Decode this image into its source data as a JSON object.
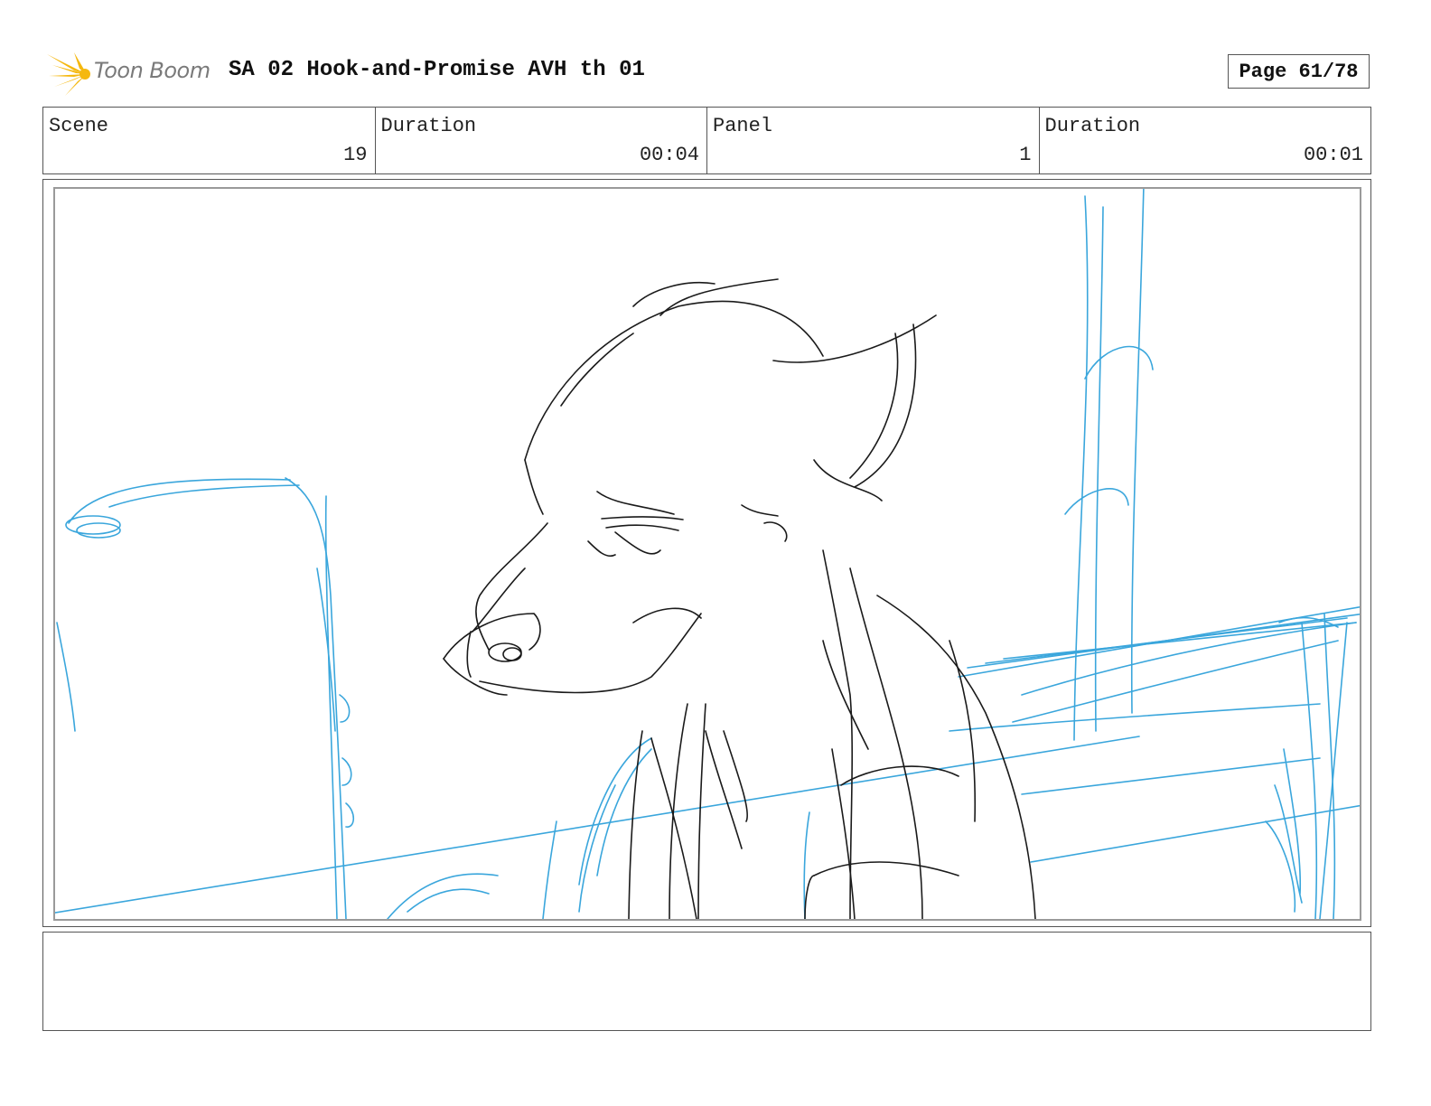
{
  "header": {
    "logo_text": "Toon Boom",
    "title": "SA 02 Hook-and-Promise AVH th 01",
    "page_label": "Page 61/78"
  },
  "info": {
    "scene_label": "Scene",
    "scene_value": "19",
    "scene_duration_label": "Duration",
    "scene_duration_value": "00:04",
    "panel_label": "Panel",
    "panel_value": "1",
    "panel_duration_label": "Duration",
    "panel_duration_value": "00:01"
  },
  "notes": {
    "text": ""
  },
  "colors": {
    "logo_accent": "#f5b80f",
    "sketch_blue": "#3aa6dc",
    "sketch_black": "#1a1a1a"
  }
}
